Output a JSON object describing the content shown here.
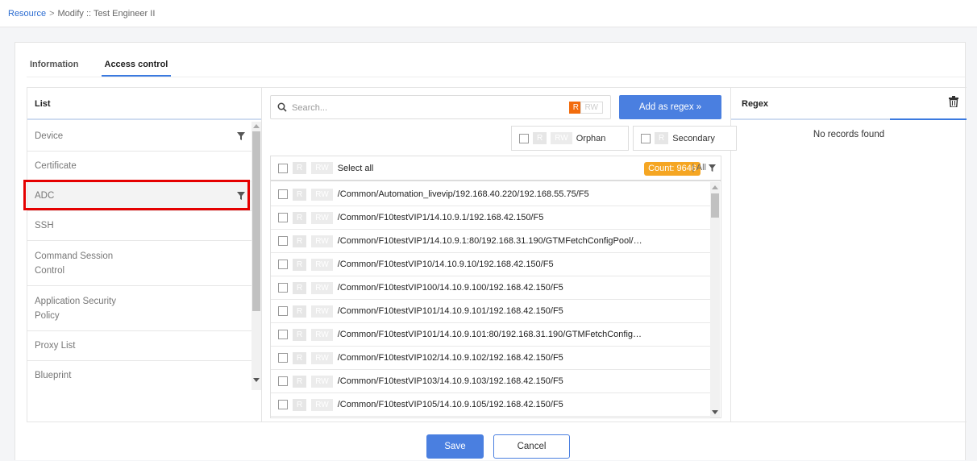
{
  "breadcrumb": {
    "root": "Resource",
    "separator": ">",
    "current": "Modify :: Test Engineer II"
  },
  "tabs": [
    {
      "label": "Information",
      "active": false
    },
    {
      "label": "Access control",
      "active": true
    }
  ],
  "list_panel": {
    "title": "List",
    "items": [
      {
        "label": "Device",
        "filter": true
      },
      {
        "label": "Certificate",
        "filter": false
      },
      {
        "label": "ADC",
        "filter": true,
        "selected": true
      },
      {
        "label": "SSH",
        "filter": false
      },
      {
        "label_line1": "Command Session",
        "label_line2": "Control",
        "filter": false
      },
      {
        "label_line1": "Application Security",
        "label_line2": "Policy",
        "filter": false
      },
      {
        "label": "Proxy List",
        "filter": false
      },
      {
        "label": "Blueprint",
        "filter": false
      }
    ]
  },
  "middle": {
    "search_placeholder": "Search...",
    "tag_r": "R",
    "tag_rw": "RW",
    "add_regex_label": "Add as regex »",
    "orphan_label": "Orphan",
    "secondary_label": "Secondary",
    "select_all_label": "Select all",
    "count_label": "Count: 9646",
    "all_label": "| All",
    "rows": [
      "/Common/Automation_livevip/192.168.40.220/192.168.55.75/F5",
      "/Common/F10testVIP1/14.10.9.1/192.168.42.150/F5",
      "/Common/F10testVIP1/14.10.9.1:80/192.168.31.190/GTMFetchConfigPool/…",
      "/Common/F10testVIP10/14.10.9.10/192.168.42.150/F5",
      "/Common/F10testVIP100/14.10.9.100/192.168.42.150/F5",
      "/Common/F10testVIP101/14.10.9.101/192.168.42.150/F5",
      "/Common/F10testVIP101/14.10.9.101:80/192.168.31.190/GTMFetchConfig…",
      "/Common/F10testVIP102/14.10.9.102/192.168.42.150/F5",
      "/Common/F10testVIP103/14.10.9.103/192.168.42.150/F5",
      "/Common/F10testVIP105/14.10.9.105/192.168.42.150/F5"
    ]
  },
  "regex_panel": {
    "title": "Regex",
    "empty_text": "No records found"
  },
  "footer": {
    "save_label": "Save",
    "cancel_label": "Cancel"
  },
  "colors": {
    "accent": "#4a7fe0",
    "tag_orange": "#f26c0d",
    "count_badge": "#f5a623",
    "highlight": "#e50000"
  }
}
